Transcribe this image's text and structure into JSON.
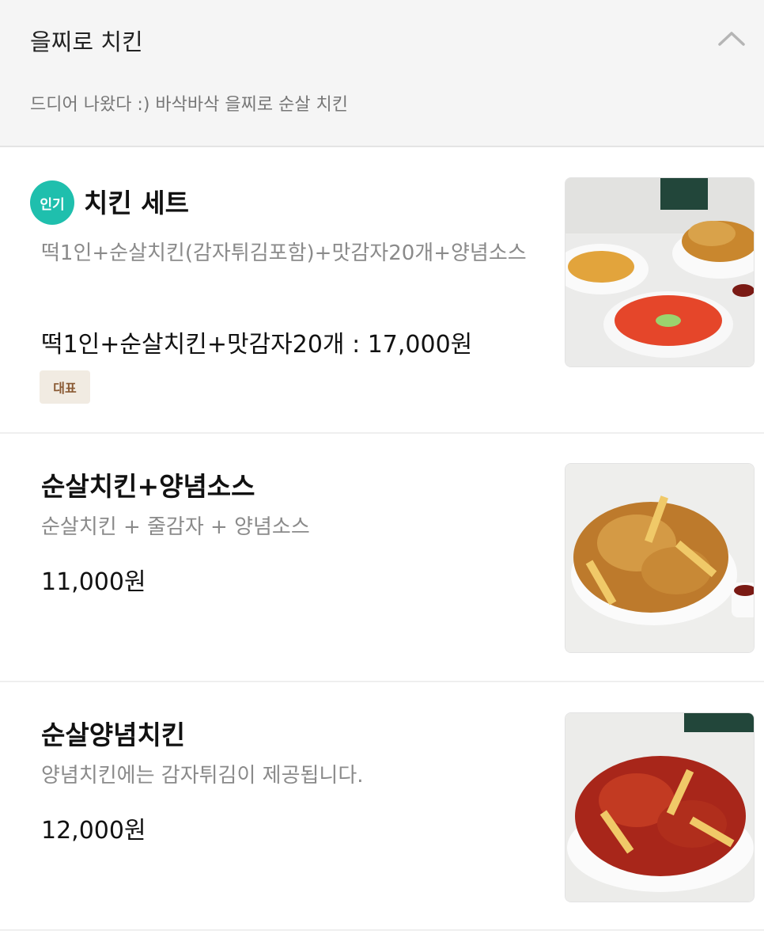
{
  "category": {
    "title": "을찌로 치킨",
    "description": "드디어 나왔다 :) 바삭바삭 을찌로 순살 치킨"
  },
  "items": [
    {
      "badge": "인기",
      "name": "치킨 세트",
      "description": "떡1인+순살치킨(감자튀김포함)+맛감자20개+양념소스",
      "price": "떡1인+순살치킨+맛감자20개 : 17,000원",
      "tag": "대표",
      "image_icon": "chicken-set-photo-icon"
    },
    {
      "name": "순살치킨+양념소스",
      "description": "순살치킨 + 줄감자 + 양념소스",
      "price": "11,000원",
      "image_icon": "fried-chicken-fries-photo-icon"
    },
    {
      "name": "순살양념치킨",
      "description": "양념치킨에는 감자튀김이 제공됩니다.",
      "price": "12,000원",
      "image_icon": "seasoned-chicken-photo-icon"
    }
  ],
  "colors": {
    "badge_teal": "#1fbfad",
    "tag_bg": "#f1ebe2",
    "tag_text": "#8a5a34",
    "header_bg": "#f5f5f5"
  }
}
